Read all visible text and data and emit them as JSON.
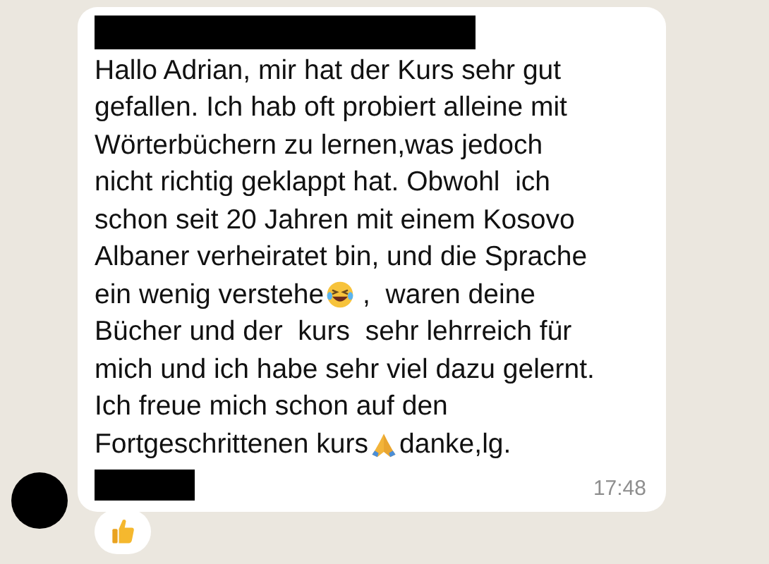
{
  "message": {
    "lines": [
      {
        "parts": [
          {
            "kind": "text",
            "text": "Hallo Adrian, mir hat der Kurs sehr gut"
          }
        ]
      },
      {
        "parts": [
          {
            "kind": "text",
            "text": "gefallen. Ich hab oft probiert alleine mit"
          }
        ]
      },
      {
        "parts": [
          {
            "kind": "text",
            "text": "Wörterbüchern zu lernen,was jedoch"
          }
        ]
      },
      {
        "parts": [
          {
            "kind": "text",
            "text": "nicht richtig geklappt hat. Obwohl  ich"
          }
        ]
      },
      {
        "parts": [
          {
            "kind": "text",
            "text": "schon seit 20 Jahren mit einem Kosovo"
          }
        ]
      },
      {
        "parts": [
          {
            "kind": "text",
            "text": "Albaner verheiratet bin, und die Sprache"
          }
        ]
      },
      {
        "parts": [
          {
            "kind": "text",
            "text": "ein wenig verstehe"
          },
          {
            "kind": "laugh"
          },
          {
            "kind": "text",
            "text": " ,  waren deine"
          }
        ]
      },
      {
        "parts": [
          {
            "kind": "text",
            "text": "Bücher und der  kurs  sehr lehrreich für"
          }
        ]
      },
      {
        "parts": [
          {
            "kind": "text",
            "text": "mich und ich habe sehr viel dazu gelernt."
          }
        ]
      },
      {
        "parts": [
          {
            "kind": "text",
            "text": "Ich freue mich schon auf den"
          }
        ]
      },
      {
        "parts": [
          {
            "kind": "text",
            "text": "Fortgeschrittenen kurs"
          },
          {
            "kind": "pray"
          },
          {
            "kind": "text",
            "text": "danke,lg."
          }
        ]
      }
    ],
    "time": "17:48"
  }
}
